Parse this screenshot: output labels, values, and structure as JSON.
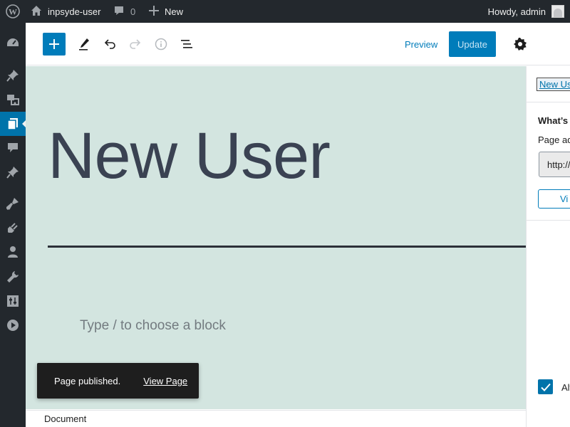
{
  "admin_bar": {
    "site_name": "inpsyde-user",
    "comments_count": "0",
    "new_label": "New",
    "howdy": "Howdy, admin"
  },
  "admin_menu": {
    "items": [
      "dashboard",
      "posts",
      "media",
      "pages",
      "comments",
      "pin",
      "appearance",
      "plugins",
      "users",
      "tools",
      "settings",
      "play"
    ],
    "current": "pages"
  },
  "toolbar": {
    "preview_label": "Preview",
    "update_label": "Update"
  },
  "editor": {
    "title": "New User",
    "block_placeholder": "Type / to choose a block",
    "background_color": "#d3e5e0"
  },
  "snackbar": {
    "message": "Page published.",
    "action": "View Page"
  },
  "footer": {
    "breadcrumb": "Document"
  },
  "sidebar": {
    "title_link": "New Us",
    "heading": "What’s n",
    "address_label": "Page ad",
    "url_value": "http://",
    "view_button": "Vi",
    "checkbox_label": "Alv",
    "checkbox_checked": true
  },
  "colors": {
    "admin_bar": "#23282d",
    "accent": "#007cba",
    "canvas": "#d3e5e0"
  }
}
